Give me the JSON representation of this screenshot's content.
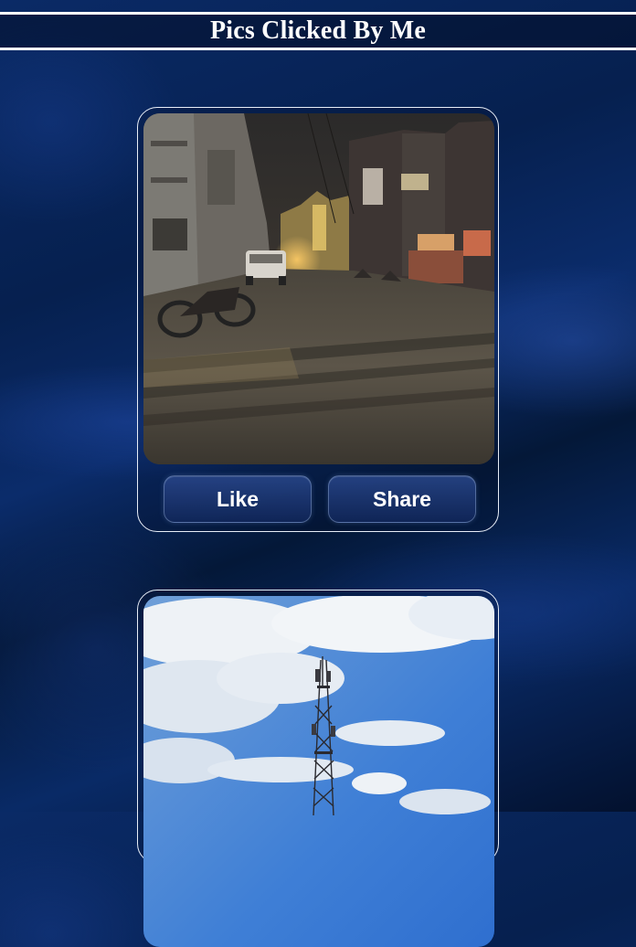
{
  "page": {
    "title": "Pics Clicked By Me"
  },
  "cards": [
    {
      "photo_description": "street",
      "like_label": "Like",
      "share_label": "Share"
    },
    {
      "photo_description": "tower"
    }
  ],
  "colors": {
    "background": "#041434",
    "header_border": "#ffffff",
    "card_border": "#e8eef8",
    "button_top": "#2a488c",
    "button_bottom": "#12285c",
    "text": "#ffffff"
  }
}
